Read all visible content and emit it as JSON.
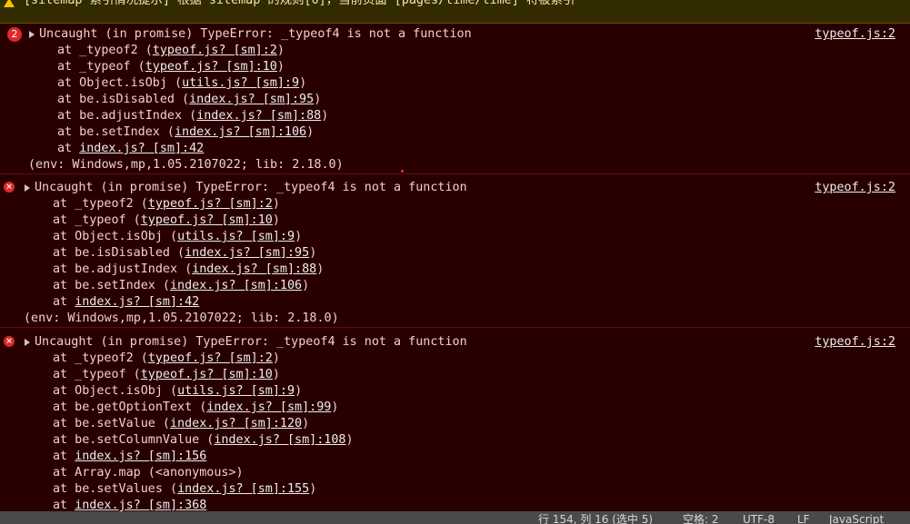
{
  "warning_bar": {
    "text": "[sitemap 索引情况提示] 根据 sitemap 的规则[0]，当前页面 [pages/time/time] 将被索引"
  },
  "errors": [
    {
      "badge": "2",
      "message": "Uncaught (in promise) TypeError: _typeof4 is not a function",
      "source": "typeof.js:2",
      "frames": [
        {
          "prefix": "at _typeof2 (",
          "link": "typeof.js? [sm]:2",
          "suffix": ")"
        },
        {
          "prefix": "at _typeof (",
          "link": "typeof.js? [sm]:10",
          "suffix": ")"
        },
        {
          "prefix": "at Object.isObj (",
          "link": "utils.js? [sm]:9",
          "suffix": ")"
        },
        {
          "prefix": "at be.isDisabled (",
          "link": "index.js? [sm]:95",
          "suffix": ")"
        },
        {
          "prefix": "at be.adjustIndex (",
          "link": "index.js? [sm]:88",
          "suffix": ")"
        },
        {
          "prefix": "at be.setIndex (",
          "link": "index.js? [sm]:106",
          "suffix": ")"
        },
        {
          "prefix": "at ",
          "link": "index.js? [sm]:42",
          "suffix": ""
        }
      ],
      "env": "(env: Windows,mp,1.05.2107022; lib: 2.18.0)"
    },
    {
      "badge": "×",
      "message": "Uncaught (in promise) TypeError: _typeof4 is not a function",
      "source": "typeof.js:2",
      "frames": [
        {
          "prefix": "at _typeof2 (",
          "link": "typeof.js? [sm]:2",
          "suffix": ")"
        },
        {
          "prefix": "at _typeof (",
          "link": "typeof.js? [sm]:10",
          "suffix": ")"
        },
        {
          "prefix": "at Object.isObj (",
          "link": "utils.js? [sm]:9",
          "suffix": ")"
        },
        {
          "prefix": "at be.isDisabled (",
          "link": "index.js? [sm]:95",
          "suffix": ")"
        },
        {
          "prefix": "at be.adjustIndex (",
          "link": "index.js? [sm]:88",
          "suffix": ")"
        },
        {
          "prefix": "at be.setIndex (",
          "link": "index.js? [sm]:106",
          "suffix": ")"
        },
        {
          "prefix": "at ",
          "link": "index.js? [sm]:42",
          "suffix": ""
        }
      ],
      "env": "(env: Windows,mp,1.05.2107022; lib: 2.18.0)"
    },
    {
      "badge": "×",
      "message": "Uncaught (in promise) TypeError: _typeof4 is not a function",
      "source": "typeof.js:2",
      "frames": [
        {
          "prefix": "at _typeof2 (",
          "link": "typeof.js? [sm]:2",
          "suffix": ")"
        },
        {
          "prefix": "at _typeof (",
          "link": "typeof.js? [sm]:10",
          "suffix": ")"
        },
        {
          "prefix": "at Object.isObj (",
          "link": "utils.js? [sm]:9",
          "suffix": ")"
        },
        {
          "prefix": "at be.getOptionText (",
          "link": "index.js? [sm]:99",
          "suffix": ")"
        },
        {
          "prefix": "at be.setValue (",
          "link": "index.js? [sm]:120",
          "suffix": ")"
        },
        {
          "prefix": "at be.setColumnValue (",
          "link": "index.js? [sm]:108",
          "suffix": ")"
        },
        {
          "prefix": "at ",
          "link": "index.js? [sm]:156",
          "suffix": ""
        },
        {
          "prefix": "at Array.map (<anonymous>)",
          "link": "",
          "suffix": ""
        },
        {
          "prefix": "at be.setValues (",
          "link": "index.js? [sm]:155",
          "suffix": ")"
        },
        {
          "prefix": "at ",
          "link": "index.js? [sm]:368",
          "suffix": ""
        }
      ],
      "env": ""
    }
  ],
  "status_bar": {
    "position": "行 154, 列 16 (选中 5)",
    "spaces": "空格: 2",
    "encoding": "UTF-8",
    "eol": "LF",
    "language": "JavaScript"
  },
  "colors": {
    "background": "#290000",
    "error_text": "#f0d0d0",
    "link": "#ededed",
    "error_icon": "#e02828",
    "warning_bg": "#332b00",
    "status_bg": "#4a4a4a"
  }
}
